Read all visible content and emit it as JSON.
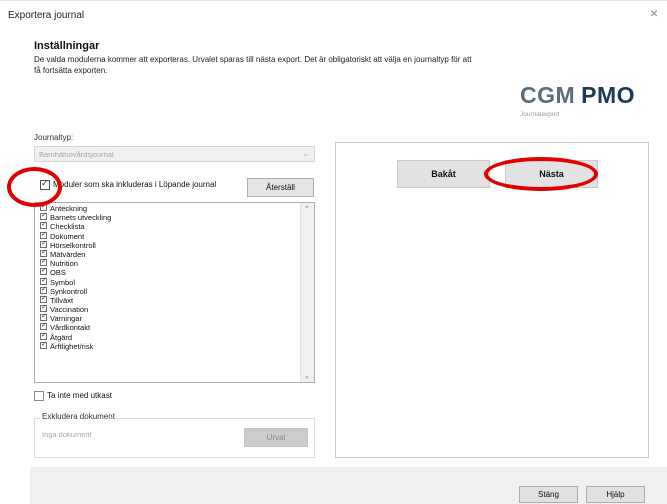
{
  "window": {
    "title": "Exportera journal",
    "close_glyph": "×"
  },
  "header": {
    "heading": "Inställningar",
    "description": "De valda modulerna kommer att exporteras. Urvalet sparas till nästa export. Det är obligatoriskt att välja en journaltyp för att få fortsätta exporten."
  },
  "logo": {
    "cgm": "CGM",
    "pmo": "PMO",
    "subtitle": "Journalexport"
  },
  "journaltyp": {
    "label": "Journaltyp:",
    "selected": "Barnhälsovårdsjournal",
    "arrow_glyph": "⌄"
  },
  "modules": {
    "header_label": "Moduler som ska inkluderas i Löpande journal",
    "header_checked": true,
    "reset_label": "Återställ",
    "items": [
      {
        "label": "Anteckning",
        "checked": true
      },
      {
        "label": "Barnets utveckling",
        "checked": true
      },
      {
        "label": "Checklista",
        "checked": true
      },
      {
        "label": "Dokument",
        "checked": true
      },
      {
        "label": "Hörselkontroll",
        "checked": true
      },
      {
        "label": "Mätvärden",
        "checked": true
      },
      {
        "label": "Nutrition",
        "checked": true
      },
      {
        "label": "OBS",
        "checked": true
      },
      {
        "label": "Symbol",
        "checked": true
      },
      {
        "label": "Synkontroll",
        "checked": true
      },
      {
        "label": "Tillväxt",
        "checked": true
      },
      {
        "label": "Vaccination",
        "checked": true
      },
      {
        "label": "Varningar",
        "checked": true
      },
      {
        "label": "Vårdkontakt",
        "checked": true
      },
      {
        "label": "Åtgärd",
        "checked": true
      },
      {
        "label": "Ärftlighet/risk",
        "checked": true
      }
    ],
    "scroll_up": "⌃",
    "scroll_down": "⌄"
  },
  "exclude_drafts": {
    "label": "Ta inte med utkast",
    "checked": false
  },
  "exclude_docs": {
    "title": "Exkludera dokument",
    "empty_text": "Inga dokument",
    "urval_label": "Urval"
  },
  "nav": {
    "back_label": "Bakåt",
    "next_label": "Nästa"
  },
  "footer": {
    "close_label": "Stäng",
    "help_label": "Hjälp"
  },
  "colors": {
    "annotation_red": "#e00000",
    "logo_dark": "#1f3a58",
    "logo_grey": "#5b6d7c"
  }
}
